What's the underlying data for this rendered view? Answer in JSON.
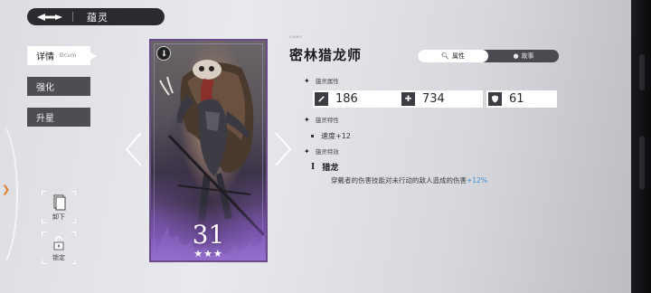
{
  "topbar": {
    "title": "蕴灵",
    "back_icon": "back-arrow-icon"
  },
  "tabs": [
    {
      "label": "详情",
      "sub": "Ðcum",
      "active": true
    },
    {
      "label": "强化",
      "active": false
    },
    {
      "label": "升星",
      "active": false
    }
  ],
  "side_buttons": [
    {
      "label": "卸下",
      "icon": "card-icon"
    },
    {
      "label": "锁定",
      "icon": "unlock-icon"
    }
  ],
  "card": {
    "level": "31",
    "stars": "★★★",
    "stars_count": 3,
    "badge_icon": "sword-icon"
  },
  "character": {
    "name_small": "ᴳᴬᴺᴱ",
    "name": "密林猎龙师"
  },
  "view_toggle": {
    "options": [
      "属性",
      "故事"
    ],
    "selected": "属性"
  },
  "sections": {
    "attributes_title": "蕴灵属性",
    "traits_title": "蕴灵特性",
    "special_title": "蕴灵特效"
  },
  "stats": [
    {
      "icon": "sword-icon",
      "value": "186"
    },
    {
      "icon": "plus-icon",
      "value": "734"
    },
    {
      "icon": "shield-icon",
      "value": "61"
    }
  ],
  "traits": [
    {
      "text": "速度+12"
    }
  ],
  "special": {
    "numeral": "I",
    "name": "猎龙",
    "desc": "穿戴者的伤害技能对未行动的敌人造成的伤害",
    "bonus": "+12%"
  },
  "colors": {
    "accent": "#3d8fd6",
    "card_frame": "#6b4a8a",
    "dark_panel": "#2a2a2f"
  }
}
